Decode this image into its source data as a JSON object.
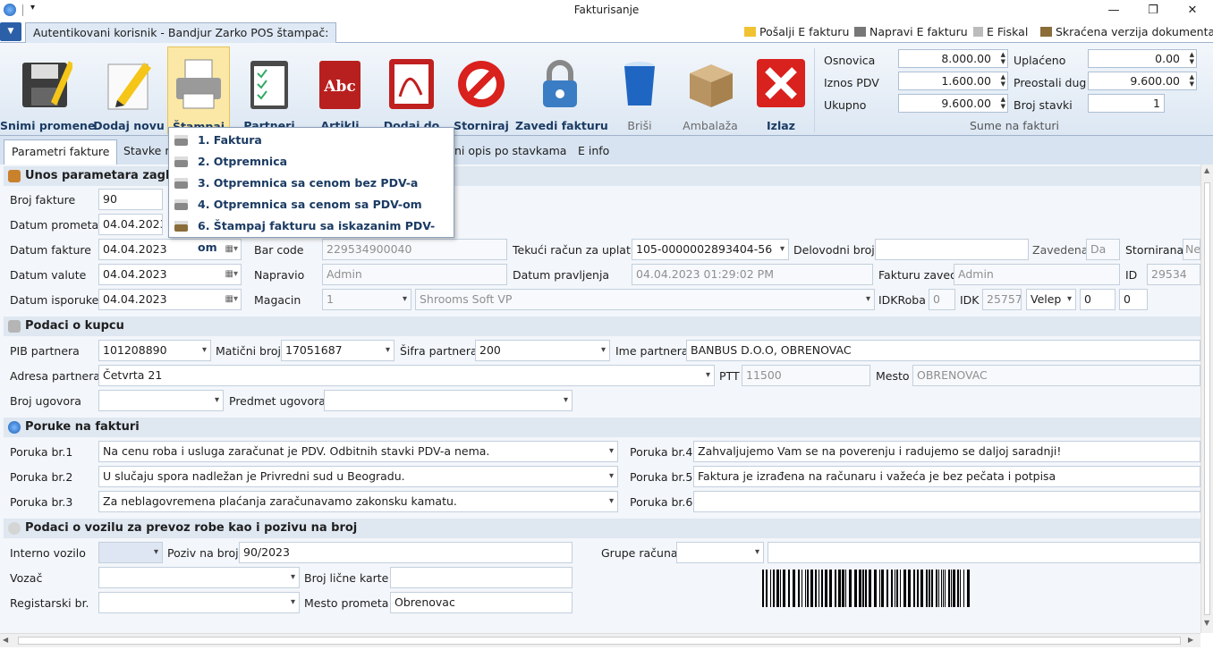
{
  "window": {
    "title": "Fakturisanje"
  },
  "tabbar": {
    "auth_tab": "Autentikovani korisnik - Bandjur Zarko POS štampač:",
    "actions": [
      "Pošalji E fakturu",
      "Napravi E fakturu",
      "E Fiskal",
      "Skraćena verzija dokumenta"
    ]
  },
  "ribbon": {
    "buttons": [
      "Snimi promene",
      "Dodaj novu",
      "Štampaj",
      "Partneri",
      "Artikli",
      "Dodaj do",
      "Storniraj",
      "Zavedi fakturu",
      "Briši",
      "Ambalaža",
      "Izlaz"
    ],
    "sums_group": "Sume na fakturi",
    "osnovica_label": "Osnovica",
    "osnovica": "8.000.00",
    "pdv_label": "Iznos PDV",
    "pdv": "1.600.00",
    "ukupno_label": "Ukupno",
    "ukupno": "9.600.00",
    "uplaceno_label": "Uplaćeno",
    "uplaceno": "0.00",
    "preostali_label": "Preostali dug",
    "preostali": "9.600.00",
    "stavki_label": "Broj stavki",
    "stavki": "1"
  },
  "page_tabs": [
    "Parametri fakture",
    "Stavke na",
    "ni opis po stavkama",
    "E info"
  ],
  "print_menu": [
    "1. Faktura",
    "2. Otpremnica",
    "3. Otpremnica sa cenom bez PDV-a",
    "4. Otpremnica sa cenom sa PDV-om",
    "6. Štampaj fakturu sa iskazanim PDV-om"
  ],
  "header_section": {
    "title": "Unos parametara zaglavlja",
    "broj_fakture_label": "Broj fakture",
    "broj_fakture": "90",
    "datum_prometa_label": "Datum prometa",
    "datum_prometa": "04.04.2023",
    "datum_fakture_label": "Datum fakture",
    "datum_fakture": "04.04.2023",
    "datum_valute_label": "Datum valute",
    "datum_valute": "04.04.2023",
    "datum_isporuke_label": "Datum isporuke",
    "datum_isporuke": "04.04.2023",
    "bar_code_label": "Bar code",
    "bar_code": "229534900040",
    "napravio_label": "Napravio",
    "napravio": "Admin",
    "magacin_label": "Magacin",
    "magacin": "1",
    "magacin_name": "Shrooms Soft VP",
    "tekuci_label": "Tekući račun za uplatu",
    "tekuci": "105-0000002893404-56",
    "datum_pravljenja_label": "Datum pravljenja",
    "datum_pravljenja": "04.04.2023 01:29:02 PM",
    "delovodni_label": "Delovodni broj",
    "delovodni": "",
    "zavedena_label": "Zavedena",
    "zavedena": "Da",
    "stornirana_label": "Stornirana",
    "stornirana": "Ne",
    "faktura_zaveo_label": "Fakturu zaveo",
    "faktura_zaveo": "Admin",
    "id_label": "ID",
    "id": "29534",
    "idkroba_label": "IDKRoba",
    "idkroba": "0",
    "idk_label": "IDK",
    "idk": "25757",
    "velep": "Velep",
    "extra1": "0",
    "extra2": "0"
  },
  "buyer_section": {
    "title": "Podaci o kupcu",
    "pib_label": "PIB partnera",
    "pib": "101208890",
    "maticni_label": "Matični broj",
    "maticni": "17051687",
    "sifra_label": "Šifra partnera",
    "sifra": "200",
    "ime_label": "Ime partnera",
    "ime": "BANBUS D.O.O, OBRENOVAC",
    "adresa_label": "Adresa partnera",
    "adresa": "Četvrta 21",
    "ptt_label": "PTT",
    "ptt": "11500",
    "mesto_label": "Mesto",
    "mesto": "OBRENOVAC",
    "ugovor_label": "Broj ugovora",
    "ugovor": "",
    "predmet_label": "Predmet ugovora",
    "predmet": ""
  },
  "messages_section": {
    "title": "Poruke na fakturi",
    "p1_label": "Poruka br.1",
    "p1": "Na cenu roba i usluga zaračunat je PDV. Odbitnih stavki PDV-a nema.",
    "p2_label": "Poruka br.2",
    "p2": "U slučaju spora nadležan je Privredni sud u Beogradu.",
    "p3_label": "Poruka br.3",
    "p3": "Za neblagovremena plaćanja zaračunavamo zakonsku kamatu.",
    "p4_label": "Poruka br.4",
    "p4": "Zahvaljujemo Vam se na poverenju i radujemo se daljoj saradnji!",
    "p5_label": "Poruka br.5",
    "p5": "Faktura je izrađena na računaru i važeća je bez pečata i potpisa",
    "p6_label": "Poruka br.6",
    "p6": ""
  },
  "vehicle_section": {
    "title": "Podaci o vozilu za prevoz robe kao i pozivu na broj",
    "interno_label": "Interno vozilo",
    "poziv_label": "Poziv na broj",
    "poziv": "90/2023",
    "grupe_label": "Grupe računa",
    "vozac_label": "Vozač",
    "licna_label": "Broj lične karte",
    "registarski_label": "Registarski br.",
    "mesto_prometa_label": "Mesto prometa",
    "mesto_prometa": "Obrenovac"
  },
  "colors": {
    "ribbon_text": "#1b3b63",
    "section_bg": "#dfe7f1",
    "accent": "#2b5fa8"
  }
}
